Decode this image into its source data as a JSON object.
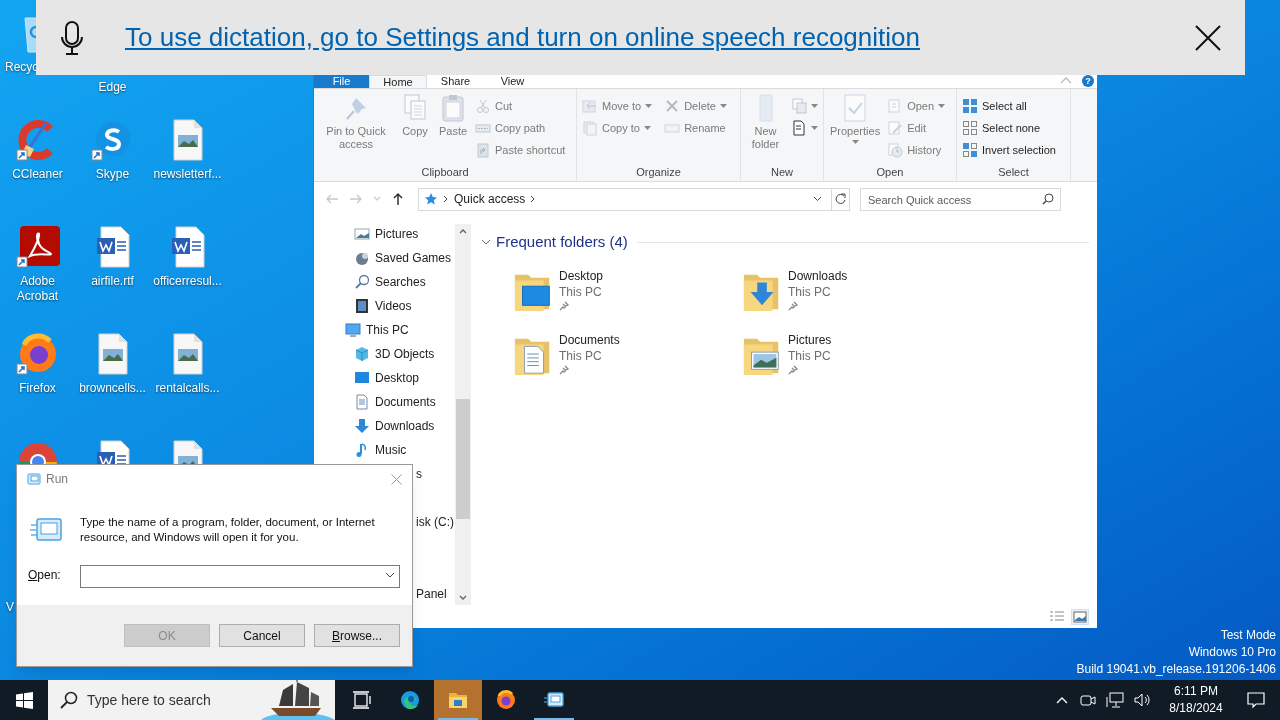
{
  "banner": {
    "message": "To use dictation, go to Settings and turn on online speech recognition"
  },
  "desktop": {
    "icon_rows": [
      [
        {
          "kind": "recycle-bin",
          "label": "Recyc"
        },
        {
          "kind": "covered",
          "label": "Edge"
        }
      ],
      [
        {
          "kind": "ccleaner",
          "label": "CCleaner",
          "shortcut": true
        },
        {
          "kind": "skype",
          "label": "Skype",
          "shortcut": true
        },
        {
          "kind": "image-file",
          "label": "newsletterf..."
        }
      ],
      [
        {
          "kind": "acrobat",
          "label": "Adobe Acrobat",
          "shortcut": true
        },
        {
          "kind": "word-file",
          "label": "airfile.rtf"
        },
        {
          "kind": "word-file",
          "label": "officerresul..."
        }
      ],
      [
        {
          "kind": "firefox",
          "label": "Firefox",
          "shortcut": true
        },
        {
          "kind": "image-file",
          "label": "browncells..."
        },
        {
          "kind": "image-file",
          "label": "rentalcalls..."
        }
      ],
      [
        {
          "kind": "chrome"
        },
        {
          "kind": "word-file"
        },
        {
          "kind": "image-file"
        }
      ]
    ],
    "cut_label": "V",
    "system_text": [
      "Test Mode",
      "Windows 10 Pro",
      "Build 19041.vb_release.191206-1406"
    ]
  },
  "explorer": {
    "ribbon_tabs": [
      {
        "label": "File",
        "kind": "file",
        "selected": false
      },
      {
        "label": "Home",
        "kind": "tab",
        "selected": true
      },
      {
        "label": "Share",
        "kind": "tab",
        "selected": false
      },
      {
        "label": "View",
        "kind": "tab",
        "selected": false
      }
    ],
    "help_button": "?",
    "ribbon_groups": [
      {
        "label": "Clipboard",
        "columns": [
          {
            "kind": "large",
            "items": [
              {
                "label": "Pin to Quick access",
                "disabled": true,
                "dropdown": false
              }
            ]
          },
          {
            "kind": "large",
            "items": [
              {
                "label": "Copy",
                "disabled": true,
                "dropdown": false
              }
            ]
          },
          {
            "kind": "large",
            "items": [
              {
                "label": "Paste",
                "disabled": true,
                "dropdown": false
              }
            ]
          },
          {
            "kind": "small",
            "items": [
              {
                "label": "Cut",
                "disabled": true,
                "dropdown": false
              },
              {
                "label": "Copy path",
                "disabled": true,
                "dropdown": false
              },
              {
                "label": "Paste shortcut",
                "disabled": true,
                "dropdown": false
              }
            ]
          }
        ]
      },
      {
        "label": "Organize",
        "columns": [
          {
            "kind": "small",
            "items": [
              {
                "label": "Move to",
                "disabled": true,
                "dropdown": true
              },
              {
                "label": "Copy to",
                "disabled": true,
                "dropdown": true
              }
            ]
          },
          {
            "kind": "small",
            "items": [
              {
                "label": "Delete",
                "disabled": true,
                "dropdown": true
              },
              {
                "label": "Rename",
                "disabled": true,
                "dropdown": false
              }
            ]
          }
        ]
      },
      {
        "label": "New",
        "columns": [
          {
            "kind": "large",
            "items": [
              {
                "label": "New folder",
                "disabled": true,
                "dropdown": false
              }
            ]
          },
          {
            "kind": "small",
            "items": [
              {
                "disabled": true,
                "dropdown": true
              },
              {
                "disabled": false,
                "dropdown": true
              }
            ]
          }
        ]
      },
      {
        "label": "Open",
        "columns": [
          {
            "kind": "large",
            "items": [
              {
                "label": "Properties",
                "disabled": true,
                "dropdown": true
              }
            ]
          },
          {
            "kind": "small",
            "items": [
              {
                "label": "Open",
                "disabled": true,
                "dropdown": true
              },
              {
                "label": "Edit",
                "disabled": true,
                "dropdown": false
              },
              {
                "label": "History",
                "disabled": true,
                "dropdown": false
              }
            ]
          }
        ]
      },
      {
        "label": "Select",
        "columns": [
          {
            "kind": "small",
            "items": [
              {
                "label": "Select all",
                "disabled": false,
                "dropdown": false
              },
              {
                "label": "Select none",
                "disabled": false,
                "dropdown": false
              },
              {
                "label": "Invert selection",
                "disabled": false,
                "dropdown": false
              }
            ]
          }
        ]
      }
    ],
    "nav_buttons": [
      {
        "disabled": true
      },
      {
        "disabled": true
      },
      {
        "disabled": true
      },
      {
        "disabled": false
      }
    ],
    "address_path": [
      "Quick access"
    ],
    "search": {
      "placeholder": "Search Quick access"
    },
    "navigation_pane": {
      "items": [
        {
          "children": [
            {
              "label": "Pictures",
              "kind": "row"
            },
            {
              "label": "Saved Games",
              "kind": "row"
            },
            {
              "label": "Searches",
              "kind": "row"
            },
            {
              "label": "Videos",
              "kind": "row"
            }
          ]
        },
        {
          "label": "This PC",
          "kind": "row",
          "children": [
            {
              "label": "3D Objects",
              "kind": "row"
            },
            {
              "label": "Desktop",
              "kind": "row"
            },
            {
              "label": "Documents",
              "kind": "row"
            },
            {
              "label": "Downloads",
              "kind": "row"
            },
            {
              "label": "Music",
              "kind": "row"
            },
            {
              "label": "s",
              "kind": "cut"
            },
            {
              "label": "isk (C:)",
              "kind": "cut"
            }
          ]
        },
        {
          "label": "Panel",
          "kind": "cut"
        }
      ]
    },
    "section": {
      "title": "Frequent folders (4)",
      "expanded": true
    },
    "folders": [
      {
        "name": "Desktop",
        "location": "This PC",
        "pinned": true
      },
      {
        "name": "Downloads",
        "location": "This PC",
        "pinned": true
      },
      {
        "name": "Documents",
        "location": "This PC",
        "pinned": true
      },
      {
        "name": "Pictures",
        "location": "This PC",
        "pinned": true
      }
    ]
  },
  "run_dialog": {
    "title": "Run",
    "message": "Type the name of a program, folder, document, or Internet resource, and Windows will open it for you.",
    "open_label": "Open:",
    "buttons": [
      {
        "label": "OK",
        "disabled": true,
        "underline_first": false
      },
      {
        "label": "Cancel",
        "disabled": false,
        "underline_first": false
      },
      {
        "label": "Browse...",
        "disabled": false,
        "underline_first": true
      }
    ]
  },
  "taskbar": {
    "search_placeholder": "Type here to search",
    "apps": [
      {
        "kind": "task-view",
        "flashing": false,
        "running": false
      },
      {
        "kind": "edge",
        "flashing": false,
        "running": false
      },
      {
        "kind": "file-explorer",
        "flashing": true,
        "running": true
      },
      {
        "kind": "firefox",
        "flashing": false,
        "running": false
      },
      {
        "kind": "run",
        "flashing": false,
        "running": true
      }
    ],
    "clock": {
      "time": "6:11 PM",
      "date": "8/18/2024"
    }
  }
}
